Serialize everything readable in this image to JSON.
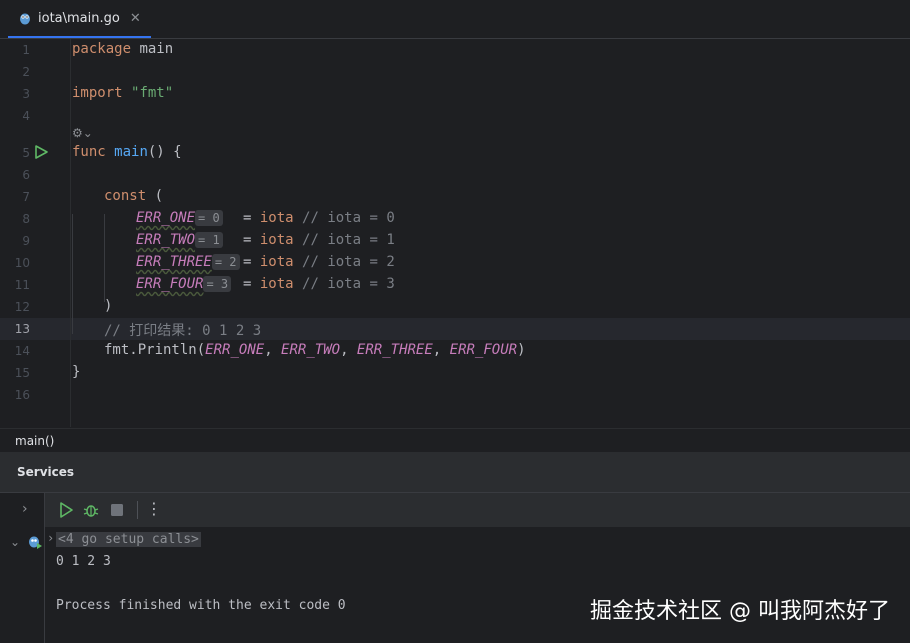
{
  "tab": {
    "label": "iota\\main.go",
    "close": "✕"
  },
  "lines": [
    {
      "n": "1",
      "text": "package main"
    },
    {
      "n": "2",
      "text": ""
    },
    {
      "n": "3",
      "text": "import \"fmt\""
    },
    {
      "n": "4",
      "text": ""
    },
    {
      "n": "5",
      "text": "func main() {"
    },
    {
      "n": "6",
      "text": ""
    },
    {
      "n": "7",
      "text": "const ("
    },
    {
      "n": "8",
      "text": "ERR_ONE = iota // iota = 0"
    },
    {
      "n": "9",
      "text": "ERR_TWO = iota // iota = 1"
    },
    {
      "n": "10",
      "text": "ERR_THREE = iota // iota = 2"
    },
    {
      "n": "11",
      "text": "ERR_FOUR = iota // iota = 3"
    },
    {
      "n": "12",
      "text": ")"
    },
    {
      "n": "13",
      "text": "// 打印结果: 0 1 2 3"
    },
    {
      "n": "14",
      "text": "fmt.Println(ERR_ONE, ERR_TWO, ERR_THREE, ERR_FOUR)"
    },
    {
      "n": "15",
      "text": "}"
    },
    {
      "n": "16",
      "text": ""
    }
  ],
  "tokens": {
    "package": "package",
    "main_pkg": "main",
    "import": "import",
    "fmt_str": "\"fmt\"",
    "func": "func",
    "main_fn": "main",
    "func_rest": "() {",
    "const": "const",
    "paren_open": " (",
    "eq": "=",
    "iota": "iota",
    "c0": "ERR_ONE",
    "c1": "ERR_TWO",
    "c2": "ERR_THREE",
    "c3": "ERR_FOUR",
    "h0": "= 0",
    "h1": "= 1",
    "h2": "= 2",
    "h3": "= 3",
    "cm0": "// iota = 0",
    "cm1": "// iota = 1",
    "cm2": "// iota = 2",
    "cm3": "// iota = 3",
    "paren_close": ")",
    "comment13": "// 打印结果: 0 1 2 3",
    "fmt": "fmt.",
    "println": "Println",
    "lp": "(",
    "comma": ", ",
    "rp": ")",
    "brace_close": "}"
  },
  "breadcrumb": "main()",
  "services": {
    "title": "Services",
    "console": {
      "setup": "<4 go setup calls>",
      "output": "0 1 2 3",
      "exit": "Process finished with the exit code 0"
    }
  },
  "watermark": "掘金技术社区 @ 叫我阿杰好了",
  "colors": {
    "keyword": "#cf8e6d",
    "string": "#6aab73",
    "function": "#56a8f5",
    "constant": "#c77dbb",
    "comment": "#7a7e85",
    "accent": "#3574f0"
  }
}
